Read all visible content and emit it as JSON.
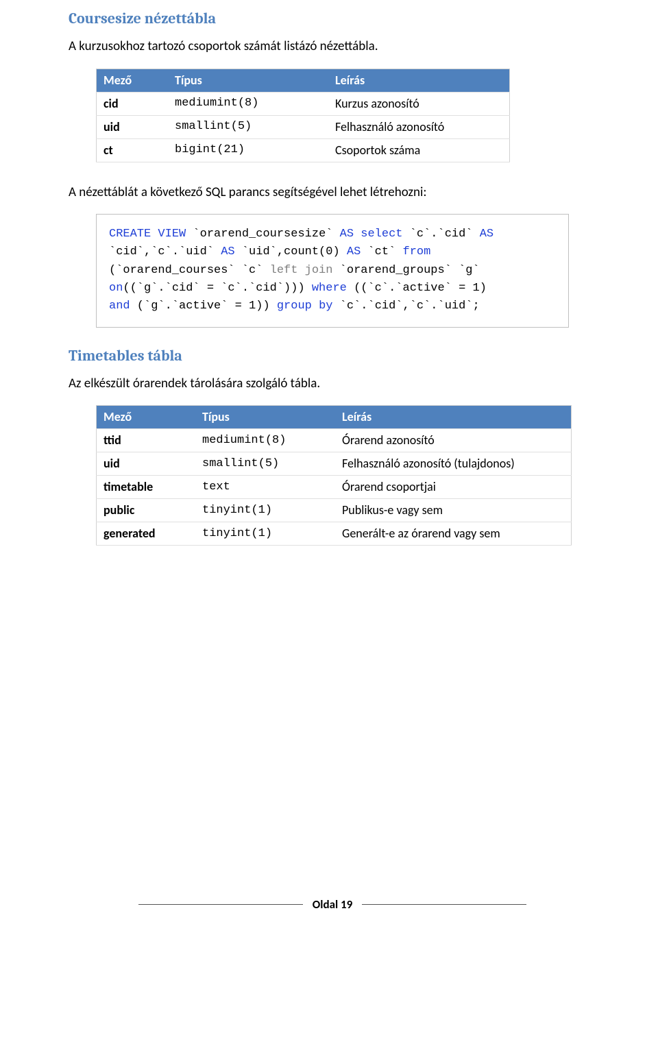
{
  "section1": {
    "title": "Coursesize nézettábla",
    "desc": "A kurzusokhoz tartozó csoportok számát listázó nézettábla."
  },
  "table1": {
    "headers": [
      "Mező",
      "Típus",
      "Leírás"
    ],
    "rows": [
      {
        "field": "cid",
        "type": "mediumint(8)",
        "desc": "Kurzus azonosító"
      },
      {
        "field": "uid",
        "type": "smallint(5)",
        "desc": "Felhasználó azonosító"
      },
      {
        "field": "ct",
        "type": "bigint(21)",
        "desc": "Csoportok száma"
      }
    ]
  },
  "between_text": "A nézettáblát a következő SQL parancs segítségével lehet létrehozni:",
  "code": {
    "p1a": "CREATE",
    "p1b": " VIEW",
    "p1c": " `orarend_coursesize` ",
    "p1d": "AS",
    "p1e": " ",
    "p1f": "select",
    "p1g": " `c`.`cid` ",
    "p1h": "AS",
    "p2a": "`cid`,`c`.`uid` ",
    "p2b": "AS",
    "p2c": " `uid`,count(0) ",
    "p2d": "AS",
    "p2e": " `ct` ",
    "p2f": "from",
    "p3a": "(`orarend_courses` `c` ",
    "p3b": "left join",
    "p3c": " `orarend_groups` `g`",
    "p4a": "on",
    "p4b": "((`g`.`cid` = `c`.`cid`))) ",
    "p4c": "where",
    "p4d": " ((`c`.`active` = 1)",
    "p5a": "and",
    "p5b": " (`g`.`active` = 1)) ",
    "p5c": "group",
    "p5d": " ",
    "p5e": "by",
    "p5f": " `c`.`cid`,`c`.`uid`;"
  },
  "section2": {
    "title": "Timetables tábla",
    "desc": "Az elkészült órarendek tárolására szolgáló tábla."
  },
  "table2": {
    "headers": [
      "Mező",
      "Típus",
      "Leírás"
    ],
    "rows": [
      {
        "field": "ttid",
        "type": "mediumint(8)",
        "desc": "Órarend azonosító"
      },
      {
        "field": "uid",
        "type": "smallint(5)",
        "desc": "Felhasználó azonosító (tulajdonos)"
      },
      {
        "field": "timetable",
        "type": "text",
        "desc": "Órarend csoportjai"
      },
      {
        "field": "public",
        "type": "tinyint(1)",
        "desc": "Publikus-e vagy sem"
      },
      {
        "field": "generated",
        "type": "tinyint(1)",
        "desc": "Generált-e az órarend vagy sem"
      }
    ]
  },
  "footer": {
    "label": "Oldal 19"
  }
}
